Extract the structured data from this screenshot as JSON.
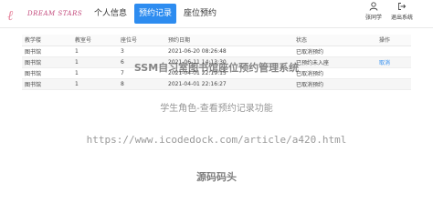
{
  "header": {
    "logo_text": "DREAM STARS",
    "nav": [
      {
        "label": "个人信息",
        "active": false
      },
      {
        "label": "预约记录",
        "active": true
      },
      {
        "label": "座位预约",
        "active": false
      }
    ],
    "user_label": "张同学",
    "logout_label": "退出系统",
    "accent": "#2d8cf0"
  },
  "table": {
    "columns": [
      "教学楼",
      "教室号",
      "座位号",
      "预约日期",
      "状态",
      "操作"
    ],
    "rows": [
      {
        "building": "图书馆",
        "room": "1",
        "seat": "3",
        "date": "2021-06-20 08:26:48",
        "status": "已取消预约",
        "action": ""
      },
      {
        "building": "图书馆",
        "room": "1",
        "seat": "6",
        "date": "2021-06-11 14:13:30",
        "status": "已预约未入座",
        "action": "取消"
      },
      {
        "building": "图书馆",
        "room": "1",
        "seat": "7",
        "date": "2021-04-01 22:19:15",
        "status": "已取消预约",
        "action": ""
      },
      {
        "building": "图书馆",
        "room": "1",
        "seat": "8",
        "date": "2021-04-01 22:16:27",
        "status": "已取消预约",
        "action": ""
      }
    ]
  },
  "watermarks": {
    "line1": "SSM自习室图书馆座位预约管理系统",
    "line2": "学生角色-查看预约记录功能",
    "line3": "https://www.icodedock.com/article/a420.html",
    "line4": "源码码头"
  }
}
